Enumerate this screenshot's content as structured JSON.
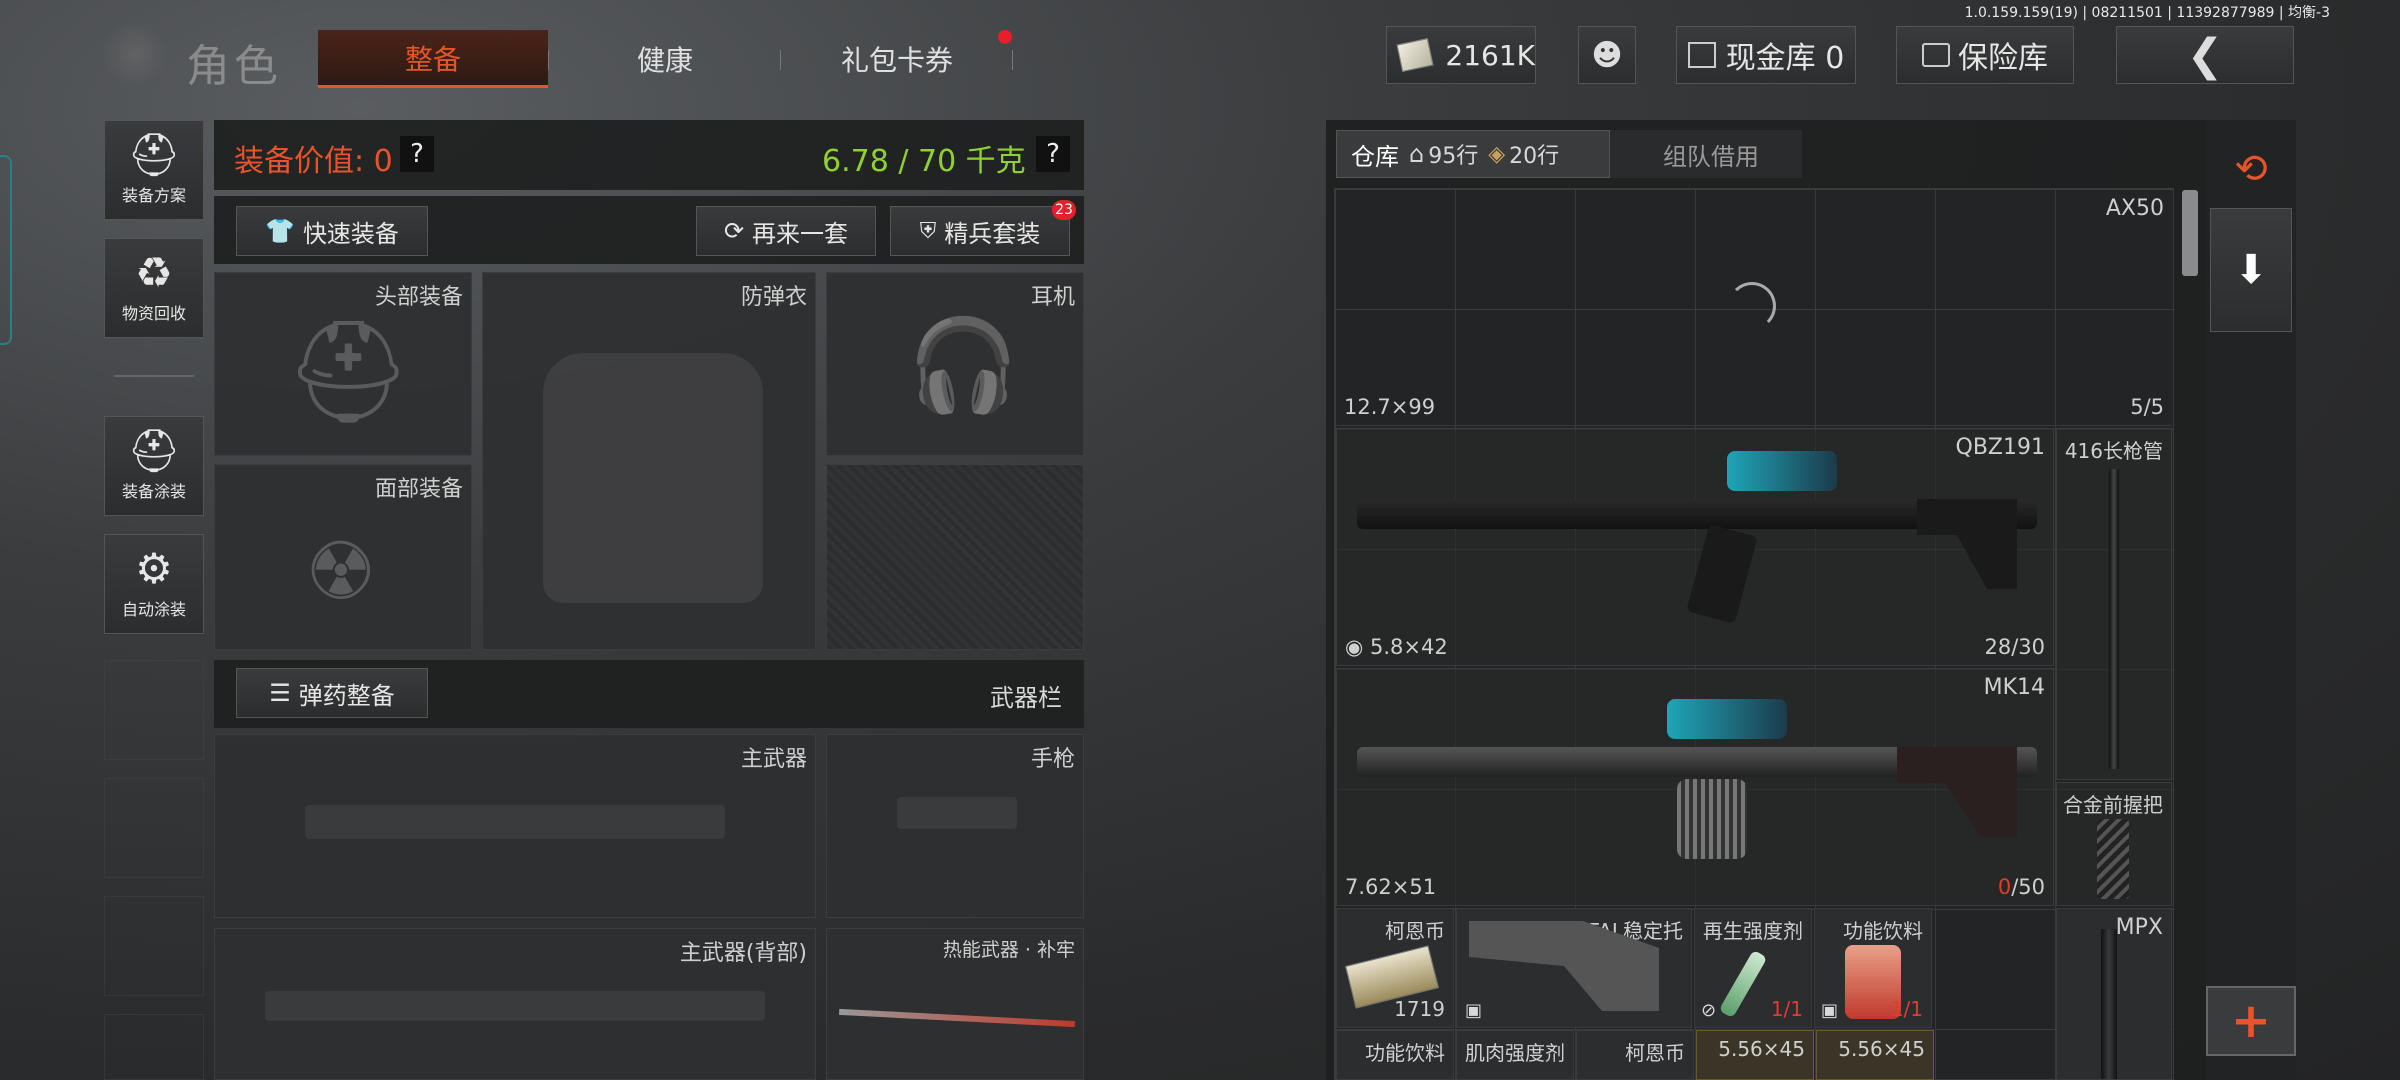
{
  "version_info": "1.0.159.159(19) | 08211501 | 11392877989 | 均衡-3",
  "top_nav": {
    "title": "角色",
    "tabs": [
      {
        "label": "整备",
        "active": true
      },
      {
        "label": "健康",
        "active": false
      },
      {
        "label": "礼包卡券",
        "active": false
      }
    ],
    "currency": "2161K",
    "cash_vault": "现金库 0",
    "safe_vault": "保险库"
  },
  "side_menu": [
    {
      "label": "装备方案"
    },
    {
      "label": "物资回收"
    },
    {
      "label": "装备涂装"
    },
    {
      "label": "自动涂装"
    }
  ],
  "loadout": {
    "value_label": "装备价值: 0",
    "weight": "6.78 / 70 千克",
    "help": "?",
    "quick_equip": "快速装备",
    "again_set": "再来一套",
    "elite_set": "精兵套装",
    "elite_badge": "23",
    "slots": {
      "head": "头部装备",
      "armor": "防弹衣",
      "headset": "耳机",
      "face": "面部装备",
      "ammo_btn": "弹药整备",
      "weapon_bar": "武器栏",
      "primary": "主武器",
      "pistol": "手枪",
      "primary_back": "主武器(背部)",
      "melee": "热能武器 · 补牢"
    }
  },
  "storage": {
    "tab_storage": "仓库",
    "rows_home": "95行",
    "rows_extra": "20行",
    "tab_team": "组队借用",
    "items": {
      "ax50": {
        "name": "AX50",
        "ammo": "12.7×99",
        "count": "5/5"
      },
      "qbz191": {
        "name": "QBZ191",
        "ammo": "5.8×42",
        "count": "28/30"
      },
      "barrel": {
        "name": "416长枪管"
      },
      "mk14": {
        "name": "MK14",
        "ammo": "7.62×51",
        "count_current": "0",
        "count_max": "/50"
      },
      "grip": {
        "name": "合金前握把"
      },
      "coin1": {
        "name": "柯恩币",
        "count": "1719"
      },
      "fal_stock": {
        "name": "FAL稳定托"
      },
      "regen": {
        "name": "再生强度剂",
        "count": "1/1"
      },
      "energy": {
        "name": "功能饮料",
        "count": "1/1"
      },
      "mpx": {
        "name": "MPX"
      },
      "row_energy2": {
        "name": "功能饮料"
      },
      "row_muscle": {
        "name": "肌肉强度剂"
      },
      "row_coin2": {
        "name": "柯恩币"
      },
      "row_ammo1": {
        "name": "5.56×45"
      },
      "row_ammo2": {
        "name": "5.56×45"
      }
    }
  },
  "colors": {
    "accent_orange": "#e8542a",
    "weight_green": "#8fd22e",
    "count_red": "#e23b2b",
    "badge_red": "#e5202a"
  }
}
